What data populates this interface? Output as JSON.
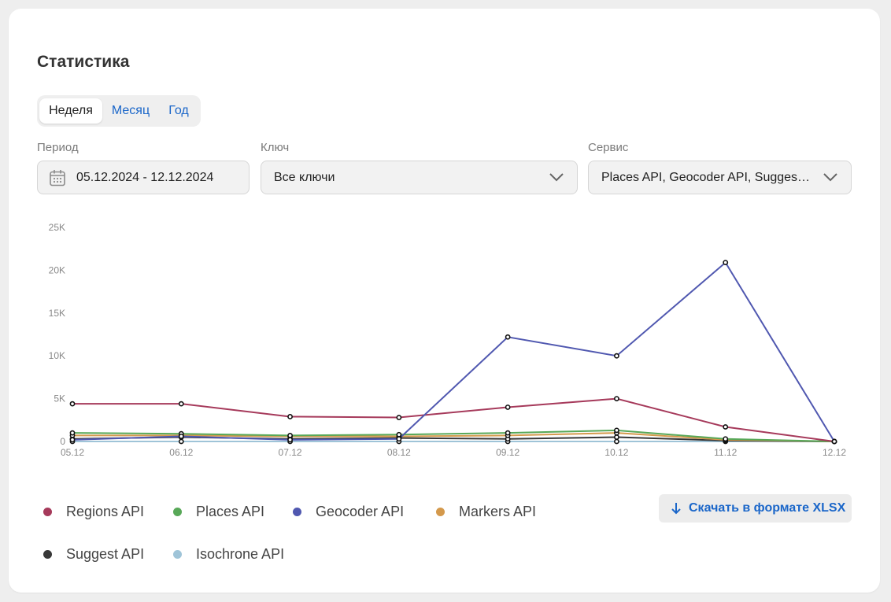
{
  "header": {
    "title": "Статистика"
  },
  "tabs": [
    {
      "label": "Неделя",
      "active": true
    },
    {
      "label": "Месяц",
      "active": false
    },
    {
      "label": "Год",
      "active": false
    }
  ],
  "filters": {
    "period": {
      "label": "Период",
      "value": "05.12.2024 - 12.12.2024",
      "icon": "calendar-icon"
    },
    "key": {
      "label": "Ключ",
      "value": "Все ключи",
      "icon": "chevron-down-icon"
    },
    "service": {
      "label": "Сервис",
      "value": "Places API, Geocoder API, Suggest API, Markers API, Regions API, Isochrone API",
      "icon": "chevron-down-icon"
    }
  },
  "chart_data": {
    "type": "line",
    "x": [
      "05.12",
      "06.12",
      "07.12",
      "08.12",
      "09.12",
      "10.12",
      "11.12",
      "12.12"
    ],
    "y_ticks": [
      0,
      5000,
      10000,
      15000,
      20000,
      25000
    ],
    "y_tick_labels": [
      "0",
      "5K",
      "10K",
      "15K",
      "20K",
      "25K"
    ],
    "ylim": [
      0,
      25000
    ],
    "grid": false,
    "legend_position": "bottom",
    "series": [
      {
        "name": "Regions API",
        "color": "#a63a5b",
        "values": [
          4400,
          4400,
          2900,
          2800,
          4000,
          5000,
          1700,
          0
        ]
      },
      {
        "name": "Places API",
        "color": "#58a858",
        "values": [
          1000,
          900,
          700,
          800,
          1000,
          1300,
          300,
          0
        ]
      },
      {
        "name": "Geocoder API",
        "color": "#5058b0",
        "values": [
          200,
          600,
          200,
          300,
          12200,
          10000,
          20900,
          0
        ]
      },
      {
        "name": "Markers API",
        "color": "#d4994c",
        "values": [
          700,
          700,
          600,
          600,
          700,
          1000,
          200,
          0
        ]
      },
      {
        "name": "Suggest API",
        "color": "#383838",
        "values": [
          300,
          500,
          300,
          400,
          300,
          500,
          100,
          0
        ]
      },
      {
        "name": "Isochrone API",
        "color": "#9fc4d8",
        "values": [
          0,
          0,
          0,
          0,
          0,
          0,
          0,
          0
        ]
      }
    ]
  },
  "download": {
    "label": "Скачать в формате XLSX",
    "icon": "arrow-down-icon",
    "color": "#1a66c9"
  }
}
